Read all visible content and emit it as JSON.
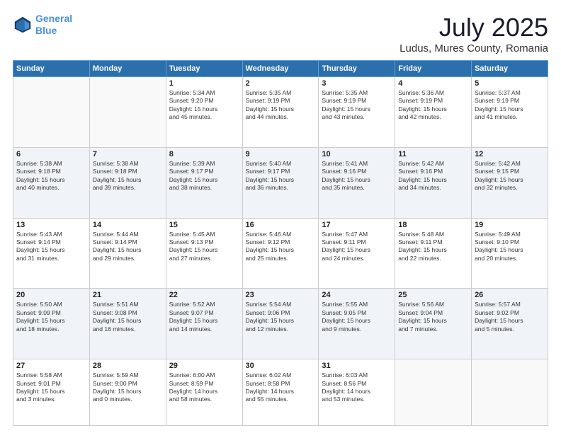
{
  "header": {
    "logo_line1": "General",
    "logo_line2": "Blue",
    "month": "July 2025",
    "location": "Ludus, Mures County, Romania"
  },
  "weekdays": [
    "Sunday",
    "Monday",
    "Tuesday",
    "Wednesday",
    "Thursday",
    "Friday",
    "Saturday"
  ],
  "weeks": [
    [
      {
        "day": "",
        "info": ""
      },
      {
        "day": "",
        "info": ""
      },
      {
        "day": "1",
        "info": "Sunrise: 5:34 AM\nSunset: 9:20 PM\nDaylight: 15 hours\nand 45 minutes."
      },
      {
        "day": "2",
        "info": "Sunrise: 5:35 AM\nSunset: 9:19 PM\nDaylight: 15 hours\nand 44 minutes."
      },
      {
        "day": "3",
        "info": "Sunrise: 5:35 AM\nSunset: 9:19 PM\nDaylight: 15 hours\nand 43 minutes."
      },
      {
        "day": "4",
        "info": "Sunrise: 5:36 AM\nSunset: 9:19 PM\nDaylight: 15 hours\nand 42 minutes."
      },
      {
        "day": "5",
        "info": "Sunrise: 5:37 AM\nSunset: 9:19 PM\nDaylight: 15 hours\nand 41 minutes."
      }
    ],
    [
      {
        "day": "6",
        "info": "Sunrise: 5:38 AM\nSunset: 9:18 PM\nDaylight: 15 hours\nand 40 minutes."
      },
      {
        "day": "7",
        "info": "Sunrise: 5:38 AM\nSunset: 9:18 PM\nDaylight: 15 hours\nand 39 minutes."
      },
      {
        "day": "8",
        "info": "Sunrise: 5:39 AM\nSunset: 9:17 PM\nDaylight: 15 hours\nand 38 minutes."
      },
      {
        "day": "9",
        "info": "Sunrise: 5:40 AM\nSunset: 9:17 PM\nDaylight: 15 hours\nand 36 minutes."
      },
      {
        "day": "10",
        "info": "Sunrise: 5:41 AM\nSunset: 9:16 PM\nDaylight: 15 hours\nand 35 minutes."
      },
      {
        "day": "11",
        "info": "Sunrise: 5:42 AM\nSunset: 9:16 PM\nDaylight: 15 hours\nand 34 minutes."
      },
      {
        "day": "12",
        "info": "Sunrise: 5:42 AM\nSunset: 9:15 PM\nDaylight: 15 hours\nand 32 minutes."
      }
    ],
    [
      {
        "day": "13",
        "info": "Sunrise: 5:43 AM\nSunset: 9:14 PM\nDaylight: 15 hours\nand 31 minutes."
      },
      {
        "day": "14",
        "info": "Sunrise: 5:44 AM\nSunset: 9:14 PM\nDaylight: 15 hours\nand 29 minutes."
      },
      {
        "day": "15",
        "info": "Sunrise: 5:45 AM\nSunset: 9:13 PM\nDaylight: 15 hours\nand 27 minutes."
      },
      {
        "day": "16",
        "info": "Sunrise: 5:46 AM\nSunset: 9:12 PM\nDaylight: 15 hours\nand 25 minutes."
      },
      {
        "day": "17",
        "info": "Sunrise: 5:47 AM\nSunset: 9:11 PM\nDaylight: 15 hours\nand 24 minutes."
      },
      {
        "day": "18",
        "info": "Sunrise: 5:48 AM\nSunset: 9:11 PM\nDaylight: 15 hours\nand 22 minutes."
      },
      {
        "day": "19",
        "info": "Sunrise: 5:49 AM\nSunset: 9:10 PM\nDaylight: 15 hours\nand 20 minutes."
      }
    ],
    [
      {
        "day": "20",
        "info": "Sunrise: 5:50 AM\nSunset: 9:09 PM\nDaylight: 15 hours\nand 18 minutes."
      },
      {
        "day": "21",
        "info": "Sunrise: 5:51 AM\nSunset: 9:08 PM\nDaylight: 15 hours\nand 16 minutes."
      },
      {
        "day": "22",
        "info": "Sunrise: 5:52 AM\nSunset: 9:07 PM\nDaylight: 15 hours\nand 14 minutes."
      },
      {
        "day": "23",
        "info": "Sunrise: 5:54 AM\nSunset: 9:06 PM\nDaylight: 15 hours\nand 12 minutes."
      },
      {
        "day": "24",
        "info": "Sunrise: 5:55 AM\nSunset: 9:05 PM\nDaylight: 15 hours\nand 9 minutes."
      },
      {
        "day": "25",
        "info": "Sunrise: 5:56 AM\nSunset: 9:04 PM\nDaylight: 15 hours\nand 7 minutes."
      },
      {
        "day": "26",
        "info": "Sunrise: 5:57 AM\nSunset: 9:02 PM\nDaylight: 15 hours\nand 5 minutes."
      }
    ],
    [
      {
        "day": "27",
        "info": "Sunrise: 5:58 AM\nSunset: 9:01 PM\nDaylight: 15 hours\nand 3 minutes."
      },
      {
        "day": "28",
        "info": "Sunrise: 5:59 AM\nSunset: 9:00 PM\nDaylight: 15 hours\nand 0 minutes."
      },
      {
        "day": "29",
        "info": "Sunrise: 6:00 AM\nSunset: 8:59 PM\nDaylight: 14 hours\nand 58 minutes."
      },
      {
        "day": "30",
        "info": "Sunrise: 6:02 AM\nSunset: 8:58 PM\nDaylight: 14 hours\nand 55 minutes."
      },
      {
        "day": "31",
        "info": "Sunrise: 6:03 AM\nSunset: 8:56 PM\nDaylight: 14 hours\nand 53 minutes."
      },
      {
        "day": "",
        "info": ""
      },
      {
        "day": "",
        "info": ""
      }
    ]
  ]
}
